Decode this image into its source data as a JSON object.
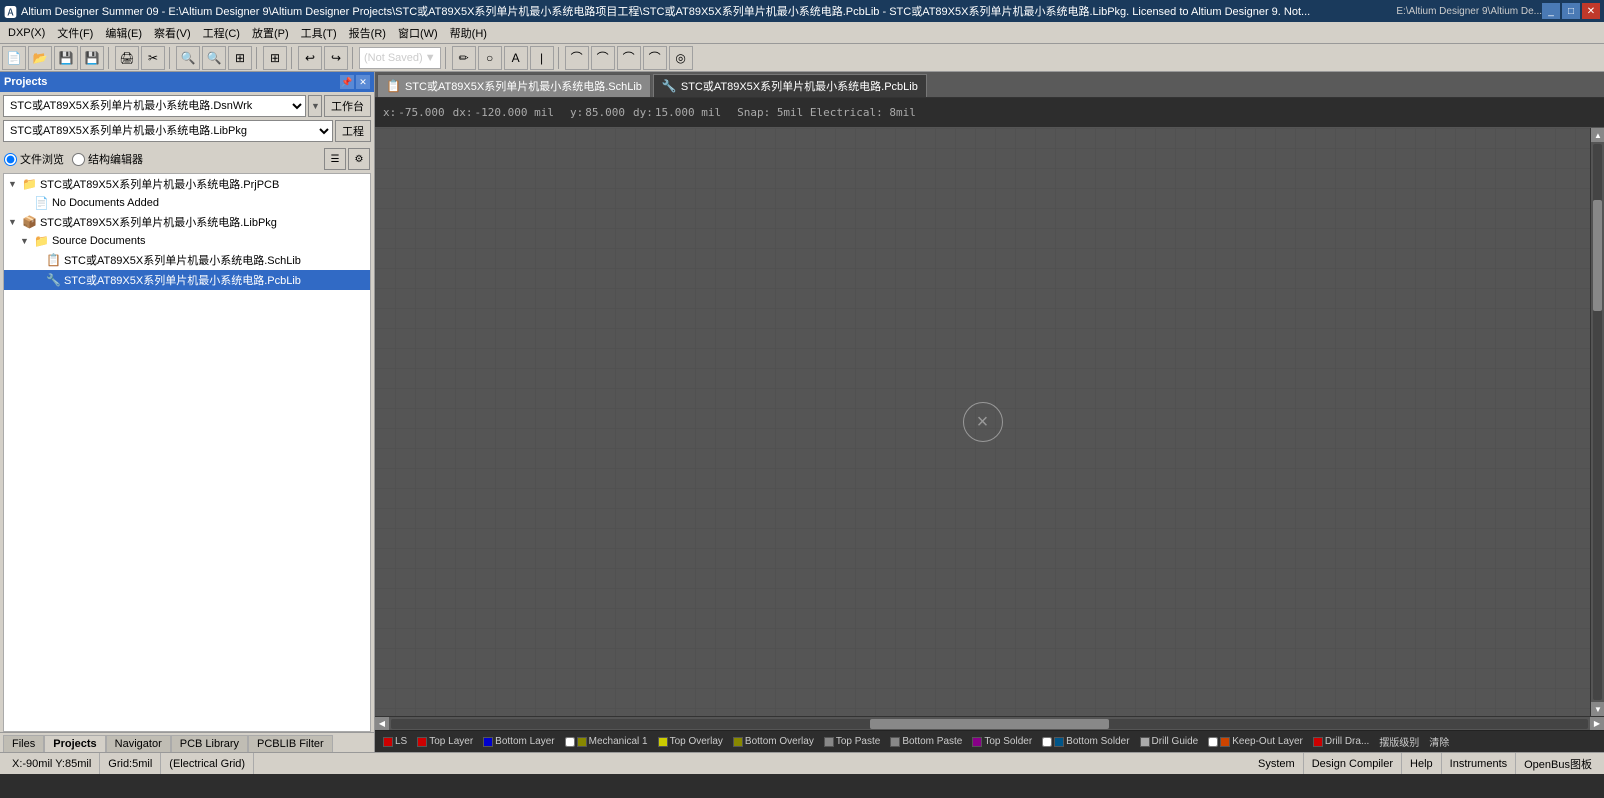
{
  "titlebar": {
    "icon": "A",
    "title": "Altium Designer Summer 09 - E:\\Altium Designer 9\\Altium Designer Projects\\STC或AT89X5X系列单片机最小系统电路项目工程\\STC或AT89X5X系列单片机最小系统电路.PcbLib - STC或AT89X5X系列单片机最小系统电路.LibPkg. Licensed to Altium Designer 9. Not...",
    "right_path": "E:\\Altium Designer 9\\Altium De...",
    "controls": [
      "_",
      "□",
      "✕"
    ]
  },
  "menubar": {
    "items": [
      "DXP(X)",
      "文件(F)",
      "编辑(E)",
      "察看(V)",
      "工程(C)",
      "放置(P)",
      "工具(T)",
      "报告(R)",
      "窗口(W)",
      "帮助(H)"
    ]
  },
  "toolbar": {
    "not_saved": "(Not Saved)"
  },
  "left_panel": {
    "title": "Projects",
    "dropdown1": "STC或AT89X5X系列单片机最小系统电路.DsnWrk",
    "btn1": "工作台",
    "dropdown2": "STC或AT89X5X系列单片机最小系统电路.LibPkg",
    "btn2": "工程",
    "radio1": "文件浏览",
    "radio2": "结构编辑器",
    "tree": [
      {
        "level": 0,
        "label": "STC或AT89X5X系列单片机最小系统电路.PrjPCB",
        "icon": "📁",
        "expanded": true,
        "type": "project"
      },
      {
        "level": 1,
        "label": "No Documents Added",
        "icon": "📄",
        "type": "nodoc",
        "color": "red"
      },
      {
        "level": 0,
        "label": "STC或AT89X5X系列单片机最小系统电路.LibPkg",
        "icon": "📦",
        "expanded": true,
        "type": "libpkg",
        "selected": false
      },
      {
        "level": 1,
        "label": "Source Documents",
        "icon": "📁",
        "expanded": true,
        "type": "folder"
      },
      {
        "level": 2,
        "label": "STC或AT89X5X系列单片机最小系统电路.SchLib",
        "icon": "📋",
        "type": "schlib"
      },
      {
        "level": 2,
        "label": "STC或AT89X5X系列单片机最小系统电路.PcbLib",
        "icon": "🔧",
        "type": "pcblib",
        "selected": true
      }
    ],
    "bottom_tabs": [
      "Files",
      "Projects",
      "Navigator",
      "PCB Library",
      "PCBLIB Filter"
    ]
  },
  "doc_tabs": [
    {
      "label": "STC或AT89X5X系列单片机最小系统电路.SchLib",
      "icon": "📋",
      "active": false
    },
    {
      "label": "STC或AT89X5X系列单片机最小系统电路.PcbLib",
      "icon": "🔧",
      "active": true
    }
  ],
  "coords": {
    "x_label": "x:",
    "x_val": "-75.000",
    "dx_label": "dx:",
    "dx_val": "-120.000 mil",
    "y_label": "y:",
    "y_val": "85.000",
    "dy_label": "dy:",
    "dy_val": "15.000  mil",
    "snap": "Snap: 5mil Electrical: 8mil"
  },
  "layers": [
    {
      "name": "LS",
      "color": "#cc0000",
      "checked": true
    },
    {
      "name": "Top Layer",
      "color": "#cc0000",
      "checked": true
    },
    {
      "name": "Bottom Layer",
      "color": "#0000cc",
      "checked": true
    },
    {
      "name": "Mechanical 1",
      "color": "#888800",
      "checked": false
    },
    {
      "name": "Top Overlay",
      "color": "#cccc00",
      "checked": true
    },
    {
      "name": "Bottom Overlay",
      "color": "#888800",
      "checked": true
    },
    {
      "name": "Top Paste",
      "color": "#888888",
      "checked": true
    },
    {
      "name": "Bottom Paste",
      "color": "#888888",
      "checked": true
    },
    {
      "name": "Top Solder",
      "color": "#880088",
      "checked": true
    },
    {
      "name": "Bottom Solder",
      "color": "#005588",
      "checked": false
    },
    {
      "name": "Drill Guide",
      "color": "#aaaaaa",
      "checked": true
    },
    {
      "name": "Keep-Out Layer",
      "color": "#cc4400",
      "checked": false
    },
    {
      "name": "Drill Dra...",
      "color": "#cc0000",
      "checked": true
    },
    {
      "name": "摆版级别",
      "color": "",
      "checked": false
    },
    {
      "name": "清除",
      "color": "",
      "checked": false
    }
  ],
  "statusbar": {
    "coords": "X:-90mil Y:85mil",
    "grid": "Grid:5mil",
    "electrical": "(Electrical Grid)",
    "system": "System",
    "design_compiler": "Design Compiler",
    "help": "Help",
    "instruments": "Instruments",
    "openbus": "OpenBus图板"
  }
}
